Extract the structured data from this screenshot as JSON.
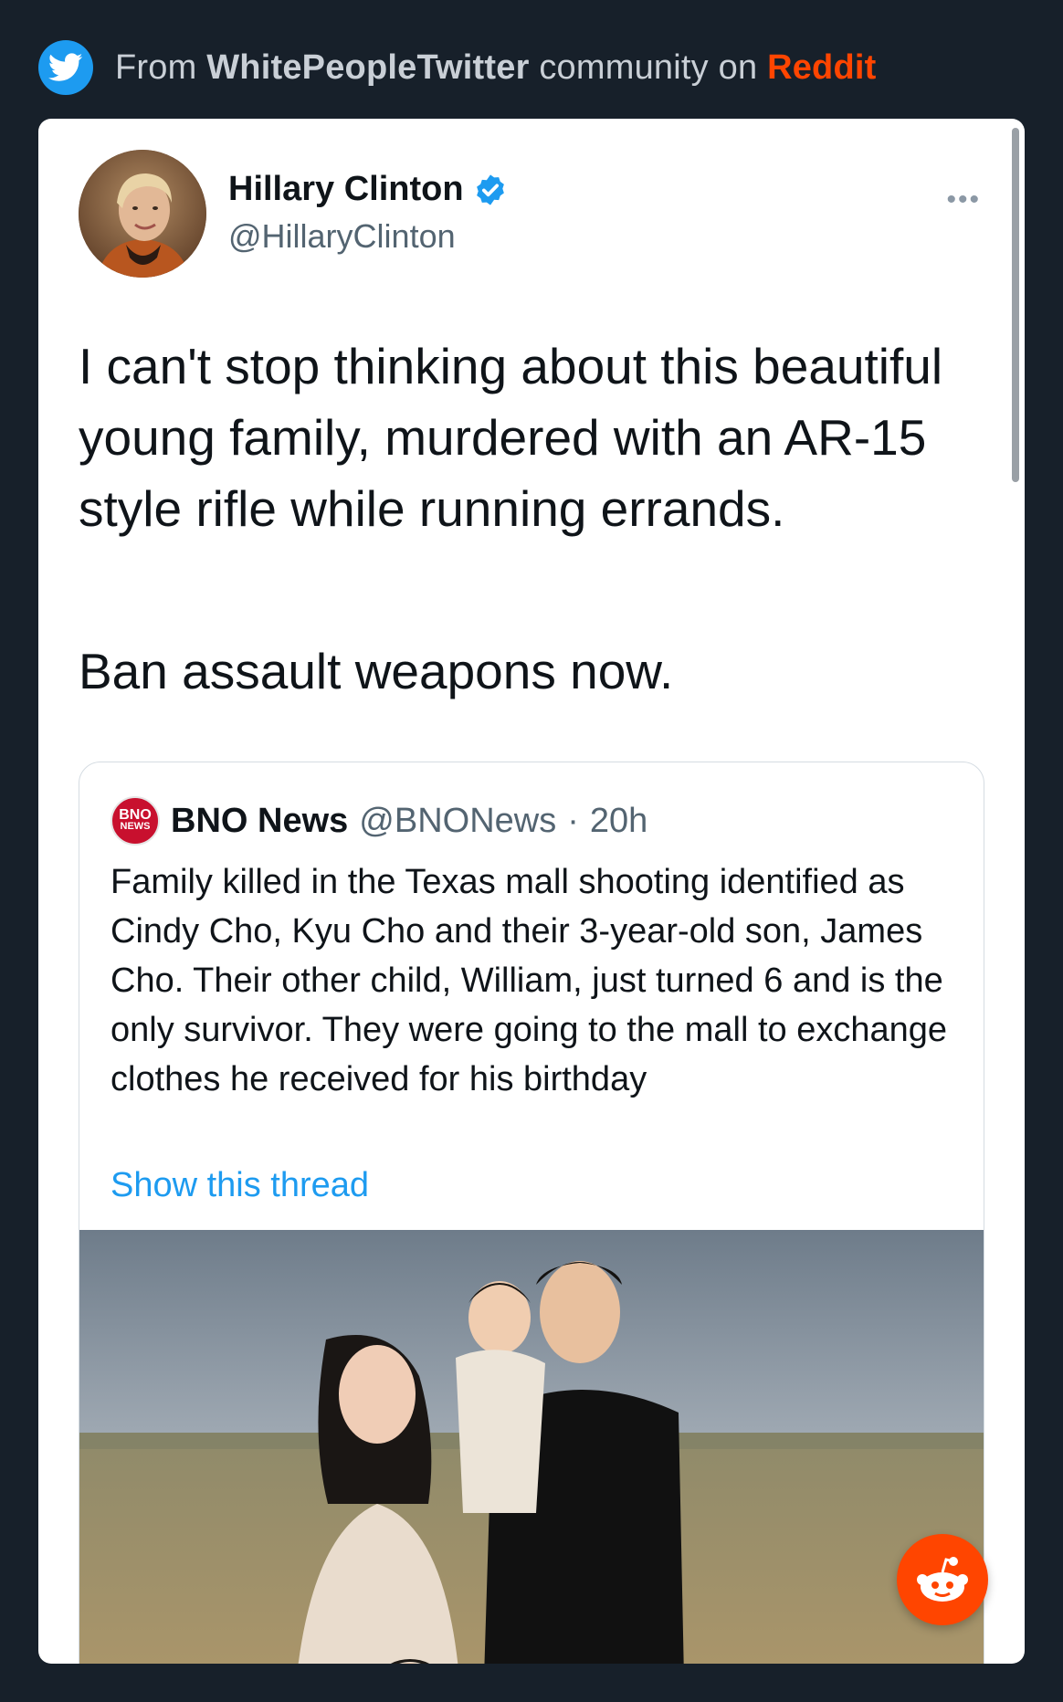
{
  "header": {
    "prefix": "From",
    "community": "WhitePeopleTwitter",
    "middle": "community on",
    "platform": "Reddit",
    "icon": "twitter-bird-icon"
  },
  "tweet": {
    "author_name": "Hillary Clinton",
    "author_handle": "@HillaryClinton",
    "verified": true,
    "more_label": "•••",
    "paragraphs": [
      "I can't stop thinking about this beautiful young family, murdered with an AR-15 style rifle while running errands.",
      "Ban assault weapons now."
    ]
  },
  "quoted": {
    "logo_top": "BNO",
    "logo_bottom": "NEWS",
    "name": "BNO News",
    "handle": "@BNONews",
    "separator": "·",
    "time": "20h",
    "text": "Family killed in the Texas mall shooting identified as Cindy Cho, Kyu Cho and their 3-year-old son, James Cho. Their other child, William, just turned 6 and is the only survivor. They were going to the mall to exchange clothes he received for his birthday",
    "link": "Show this thread"
  },
  "colors": {
    "background": "#17202a",
    "reddit": "#ff4500",
    "twitter_blue": "#1d9bf0"
  }
}
